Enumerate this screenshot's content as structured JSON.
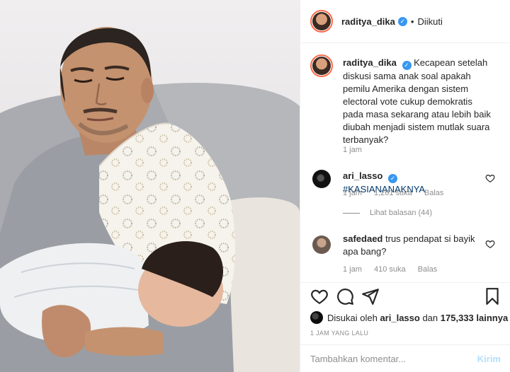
{
  "post": {
    "author": "raditya_dika",
    "follow_state": "Diikuti",
    "follow_separator": "•",
    "verified_mark": "✓"
  },
  "caption": {
    "username": "raditya_dika",
    "text": "Kecapean setelah diskusi sama anak soal apakah pemilu Amerika dengan sistem electoral vote cukup demokratis pada masa sekarang atau lebih baik diubah menjadi sistem mutlak suara terbanyak?",
    "time": "1 jam"
  },
  "comments": [
    {
      "username": "ari_lasso",
      "verified": true,
      "text": "#KASIANANAKNYA",
      "time": "1 jam",
      "likes": "1,261 suka",
      "reply": "Balas",
      "view_replies": "Lihat balasan (44)"
    },
    {
      "username": "safedaed",
      "verified": false,
      "text": "trus pendapat si bayik apa bang?",
      "time": "1 jam",
      "likes": "410 suka",
      "reply": "Balas"
    }
  ],
  "actions": {
    "icons": [
      "heart-icon",
      "comment-icon",
      "share-icon",
      "bookmark-icon"
    ],
    "liked_by_prefix": "Disukai oleh",
    "liked_by_user": "ari_lasso",
    "liked_by_conj": "dan",
    "liked_by_count": "175,333",
    "liked_by_suffix": "lainnya",
    "timestamp": "1 JAM YANG LALU"
  },
  "add_comment": {
    "placeholder": "Tambahkan komentar...",
    "submit_label": "Kirim"
  },
  "colors": {
    "link": "#00376b",
    "verified": "#3897f0",
    "muted": "#8e8e8e",
    "submit_disabled": "#b2dffc"
  }
}
